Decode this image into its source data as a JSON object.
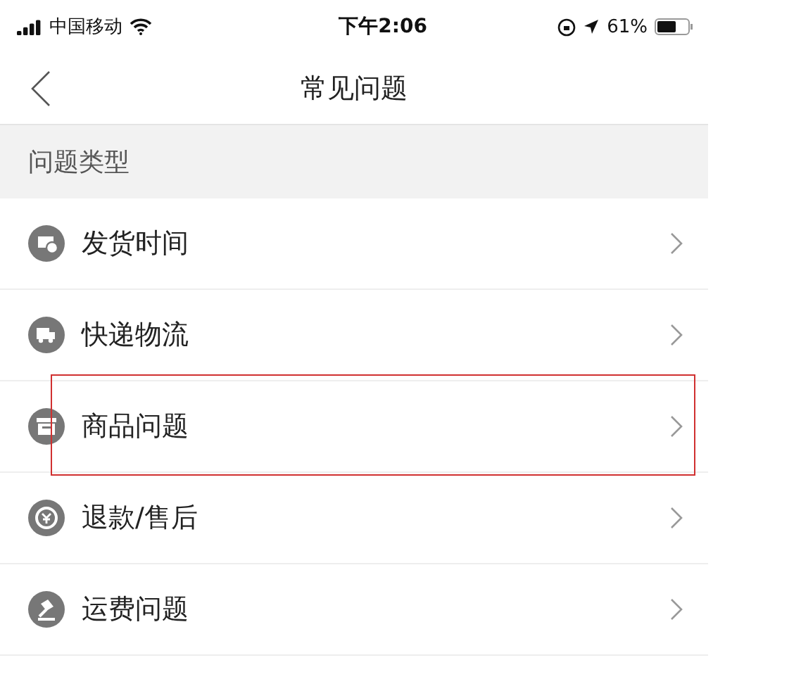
{
  "status_bar": {
    "carrier": "中国移动",
    "time": "下午2:06",
    "battery": "61%"
  },
  "nav": {
    "title": "常见问题"
  },
  "section": {
    "title": "问题类型"
  },
  "items": [
    {
      "label": "发货时间",
      "kind": "shipping",
      "annotated": false
    },
    {
      "label": "快递物流",
      "kind": "truck",
      "annotated": false
    },
    {
      "label": "商品问题",
      "kind": "box",
      "annotated": true
    },
    {
      "label": "退款/售后",
      "kind": "refund",
      "annotated": false
    },
    {
      "label": "运费问题",
      "kind": "gavel",
      "annotated": false
    }
  ]
}
